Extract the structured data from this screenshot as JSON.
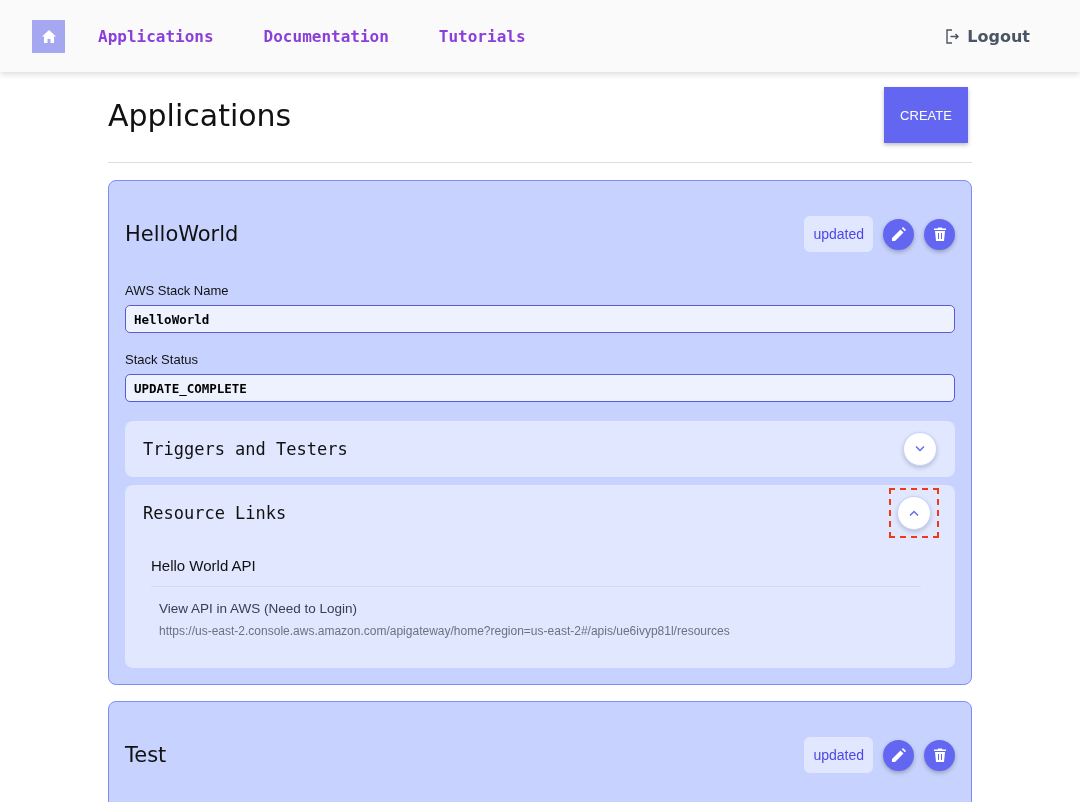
{
  "nav": {
    "links": [
      {
        "label": "Applications"
      },
      {
        "label": "Documentation"
      },
      {
        "label": "Tutorials"
      }
    ],
    "logout": "Logout"
  },
  "page": {
    "title": "Applications",
    "create_button": "CREATE"
  },
  "applications": [
    {
      "name": "HelloWorld",
      "badge": "updated",
      "fields": [
        {
          "label": "AWS Stack Name",
          "value": "HelloWorld"
        },
        {
          "label": "Stack Status",
          "value": "UPDATE_COMPLETE"
        }
      ],
      "sections": [
        {
          "title": "Triggers and Testers",
          "expanded": false,
          "highlighted": false
        },
        {
          "title": "Resource Links",
          "expanded": true,
          "highlighted": true,
          "resources": [
            {
              "heading": "Hello World API",
              "links": [
                {
                  "title": "View API in AWS (Need to Login)",
                  "url": "https://us-east-2.console.aws.amazon.com/apigateway/home?region=us-east-2#/apis/ue6ivyp81l/resources"
                }
              ]
            }
          ]
        }
      ]
    },
    {
      "name": "Test",
      "badge": "updated"
    }
  ]
}
